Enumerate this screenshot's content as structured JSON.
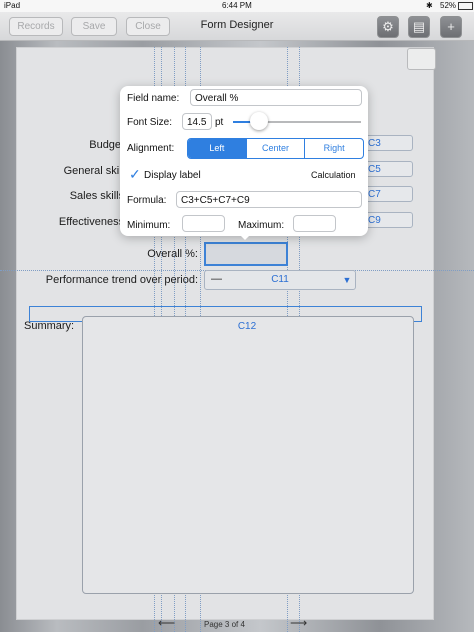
{
  "status_bar": {
    "device": "iPad",
    "time": "6:44 PM",
    "battery": "52%"
  },
  "toolbar": {
    "records_label": "Records",
    "save_label": "Save",
    "close_label": "Close",
    "title": "Form Designer",
    "icons": [
      "gear-icon",
      "document-icon",
      "plus-icon"
    ]
  },
  "form": {
    "labels": {
      "budget": "Budget %:",
      "general_skill": "General skill %:",
      "sales_skills": "Sales skills %:",
      "effectiveness": "Effectiveness %:",
      "overall": "Overall %:",
      "trend": "Performance trend over period:",
      "summary": "Summary:"
    },
    "cells": {
      "budget": "C3",
      "general_skill": "C5",
      "sales_skills": "C7",
      "effectiveness": "C9",
      "trend": "C11",
      "summary": "C12"
    },
    "trend_value": "—"
  },
  "popover": {
    "field_name_label": "Field name:",
    "field_name_value": "Overall %",
    "font_size_label": "Font Size:",
    "font_size_value": "14.5",
    "font_size_unit": "pt",
    "font_size_slider_fraction": 0.2,
    "alignment_label": "Alignment:",
    "alignment_options": [
      "Left",
      "Center",
      "Right"
    ],
    "alignment_selected": "Left",
    "display_label": "Display label",
    "display_label_checked": true,
    "calculation_label": "Calculation",
    "formula_label": "Formula:",
    "formula_value": "C3+C5+C7+C9",
    "minimum_label": "Minimum:",
    "maximum_label": "Maximum:"
  },
  "page_nav": {
    "page_label": "Page 3 of 4"
  },
  "colors": {
    "accent": "#2f7fe0",
    "cell_text": "#2c6fd3"
  }
}
